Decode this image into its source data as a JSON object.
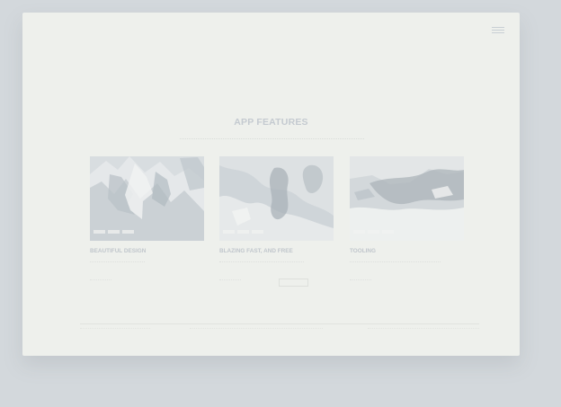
{
  "section": {
    "title": "APP FEATURES"
  },
  "cards": [
    {
      "title": "BEAUTIFUL DESIGN",
      "image_icon": "photo-icon"
    },
    {
      "title": "BLAZING FAST, AND FREE",
      "image_icon": "photo-icon"
    },
    {
      "title": "TOOLING",
      "image_icon": "photo-icon"
    }
  ],
  "icons": {
    "menu": "menu-icon"
  },
  "colors": {
    "background": "#d3d8dc",
    "window": "#eef0ec",
    "heading": "#c4cad0",
    "muted_text": "#c0c6cc",
    "image_placeholder": "#d8dde0"
  }
}
